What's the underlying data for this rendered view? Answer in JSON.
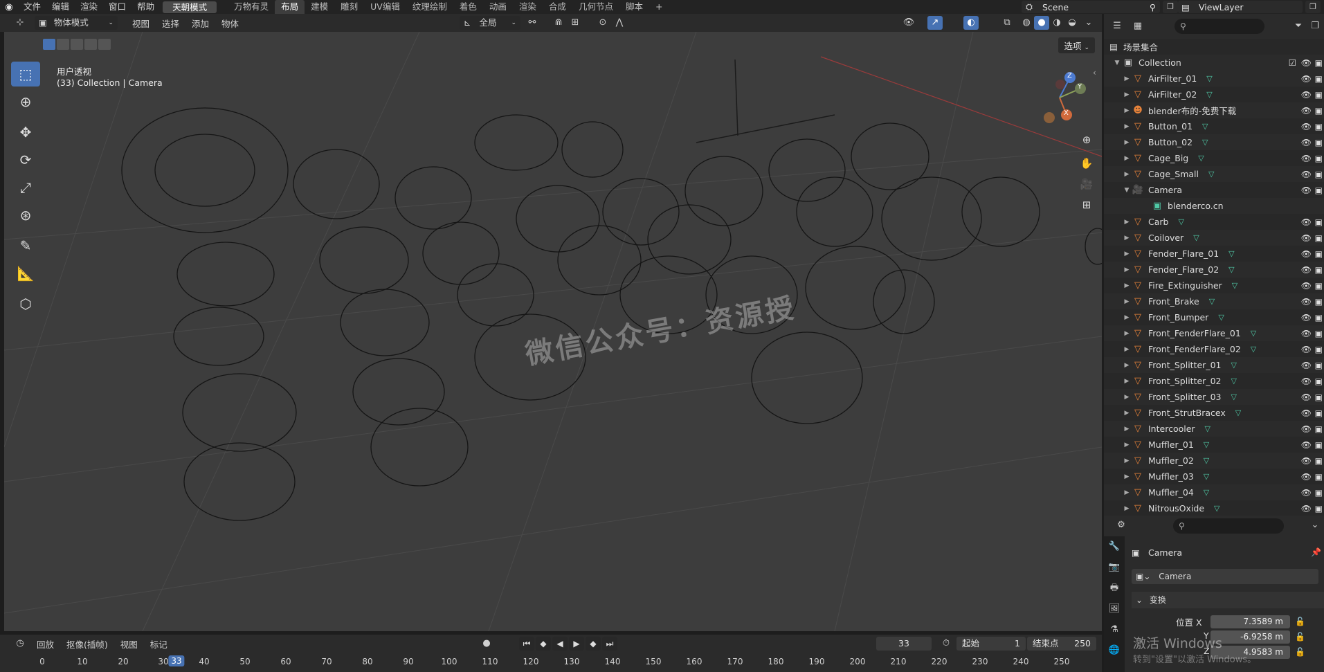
{
  "topbar": {
    "menus": [
      "文件",
      "编辑",
      "渲染",
      "窗口",
      "帮助"
    ],
    "mode_button": "天朝模式",
    "workspaces": [
      "万物有灵",
      "布局",
      "建模",
      "雕刻",
      "UV编辑",
      "纹理绘制",
      "着色",
      "动画",
      "渲染",
      "合成",
      "几何节点",
      "脚本"
    ],
    "active_workspace": "布局",
    "add_tab": "+",
    "scene": "Scene",
    "view_layer": "ViewLayer"
  },
  "viewport_header": {
    "mode": "物体模式",
    "menus": [
      "视图",
      "选择",
      "添加",
      "物体"
    ],
    "transform_orientation": "全局",
    "options": "选项"
  },
  "viewport": {
    "view_name": "用户透视",
    "collection_info": "(33) Collection | Camera",
    "watermark": "微信公众号：资源授"
  },
  "gizmo": {
    "z": "Z",
    "y": "Y",
    "x": "X"
  },
  "timeline": {
    "menus": [
      "回放",
      "抠像(插帧)",
      "视图",
      "标记"
    ],
    "current_frame": "33",
    "start_label": "起始",
    "start_value": "1",
    "end_label": "结束点",
    "end_value": "250",
    "ticks": [
      "0",
      "10",
      "20",
      "30",
      "40",
      "50",
      "60",
      "70",
      "80",
      "90",
      "100",
      "110",
      "120",
      "130",
      "140",
      "150",
      "160",
      "170",
      "180",
      "190",
      "200",
      "210",
      "220",
      "230",
      "240",
      "250"
    ]
  },
  "outliner": {
    "scene_collection": "场景集合",
    "collection": "Collection",
    "items": [
      {
        "name": "AirFilter_01",
        "type": "mesh"
      },
      {
        "name": "AirFilter_02",
        "type": "mesh"
      },
      {
        "name": "blender布的-免费下载",
        "type": "empty"
      },
      {
        "name": "Button_01",
        "type": "mesh"
      },
      {
        "name": "Button_02",
        "type": "mesh"
      },
      {
        "name": "Cage_Big",
        "type": "mesh"
      },
      {
        "name": "Cage_Small",
        "type": "mesh"
      },
      {
        "name": "Camera",
        "type": "camera"
      },
      {
        "name": "blenderco.cn",
        "type": "camera-data"
      },
      {
        "name": "Carb",
        "type": "mesh"
      },
      {
        "name": "Coilover",
        "type": "mesh"
      },
      {
        "name": "Fender_Flare_01",
        "type": "mesh"
      },
      {
        "name": "Fender_Flare_02",
        "type": "mesh"
      },
      {
        "name": "Fire_Extinguisher",
        "type": "mesh"
      },
      {
        "name": "Front_Brake",
        "type": "mesh"
      },
      {
        "name": "Front_Bumper",
        "type": "mesh"
      },
      {
        "name": "Front_FenderFlare_01",
        "type": "mesh"
      },
      {
        "name": "Front_FenderFlare_02",
        "type": "mesh"
      },
      {
        "name": "Front_Splitter_01",
        "type": "mesh"
      },
      {
        "name": "Front_Splitter_02",
        "type": "mesh"
      },
      {
        "name": "Front_Splitter_03",
        "type": "mesh"
      },
      {
        "name": "Front_StrutBracex",
        "type": "mesh"
      },
      {
        "name": "Intercooler",
        "type": "mesh"
      },
      {
        "name": "Muffler_01",
        "type": "mesh"
      },
      {
        "name": "Muffler_02",
        "type": "mesh"
      },
      {
        "name": "Muffler_03",
        "type": "mesh"
      },
      {
        "name": "Muffler_04",
        "type": "mesh"
      },
      {
        "name": "NitrousOxide",
        "type": "mesh"
      }
    ]
  },
  "properties": {
    "object_name": "Camera",
    "data_name": "Camera",
    "section": "变换",
    "location_label": "位置 X",
    "location_y_label": "Y",
    "location_z_label": "Z",
    "loc_x": "7.3589 m",
    "loc_y": "-6.9258 m",
    "loc_z": "4.9583 m"
  },
  "os_overlay": {
    "line1": "激活 Windows",
    "line2": "转到\"设置\"以激活 Windows。"
  },
  "colors": {
    "accent": "#4772b3",
    "object_orange": "#e8833a",
    "mesh_green": "#4fc9a6"
  }
}
